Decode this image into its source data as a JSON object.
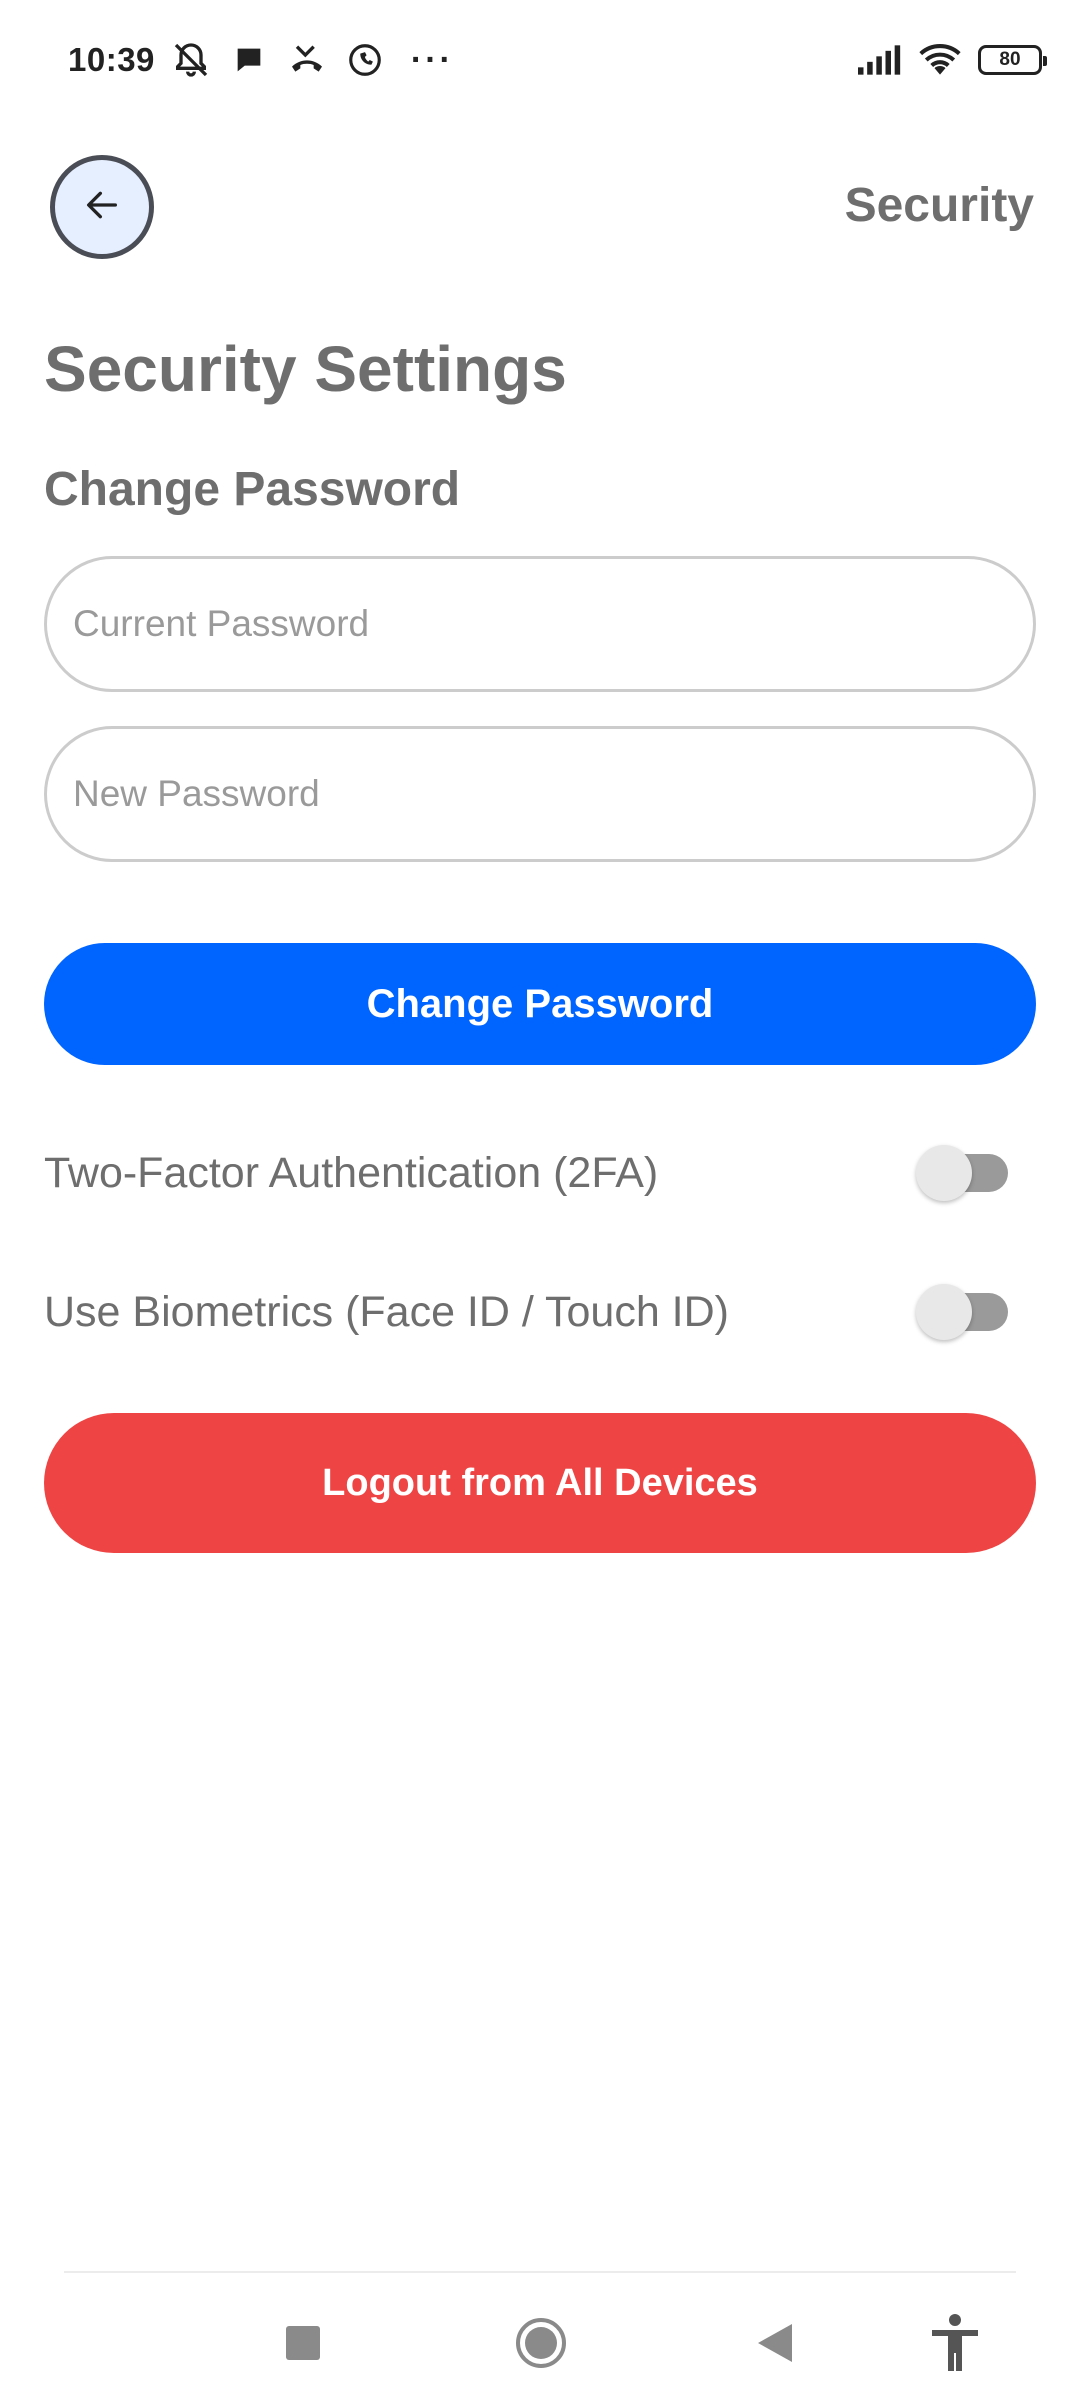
{
  "status_bar": {
    "time": "10:39",
    "battery": "80",
    "icons": [
      "mute-bell-icon",
      "chat-bubble-icon",
      "missed-call-icon",
      "whatsapp-icon",
      "more-dots-icon",
      "signal-icon",
      "wifi-icon",
      "battery-icon"
    ],
    "more": "···"
  },
  "header": {
    "back_icon": "arrow-left-icon",
    "title": "Security"
  },
  "page": {
    "title": "Security Settings",
    "section_title": "Change Password"
  },
  "form": {
    "current_password": {
      "value": "",
      "placeholder": "Current Password"
    },
    "new_password": {
      "value": "",
      "placeholder": "New Password"
    },
    "submit_label": "Change Password"
  },
  "settings": {
    "two_factor": {
      "label": "Two-Factor Authentication (2FA)",
      "enabled": false
    },
    "biometrics": {
      "label": "Use Biometrics (Face ID / Touch ID)",
      "enabled": false
    }
  },
  "logout_all_label": "Logout from All Devices",
  "colors": {
    "primary": "#0064ff",
    "danger": "#ef4444",
    "text_muted": "#6e6e6e",
    "back_button_bg": "#e6efff"
  },
  "nav_bar": {
    "icons": [
      "recents-square-icon",
      "home-circle-icon",
      "back-triangle-icon",
      "accessibility-icon"
    ]
  }
}
